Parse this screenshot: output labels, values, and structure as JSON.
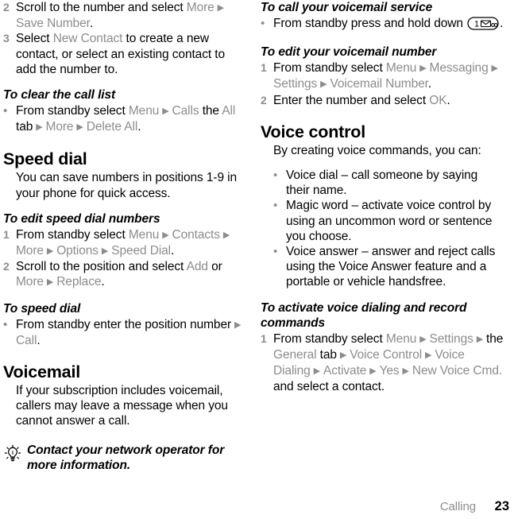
{
  "document": {
    "footer": {
      "chapter": "Calling",
      "page_number": "23"
    }
  },
  "left_column": {
    "blocks": [
      {
        "type": "numbered-item",
        "number": "2",
        "segments": [
          {
            "text": "Scroll to the number and select ",
            "style": "plain"
          },
          {
            "text": "More",
            "style": "ui"
          },
          {
            "text": " ▶ ",
            "style": "arrow"
          },
          {
            "text": "Save Number",
            "style": "ui"
          },
          {
            "text": ".",
            "style": "plain"
          }
        ],
        "plain_text": "2 Scroll to the number and select More ▶ Save Number."
      },
      {
        "type": "numbered-item",
        "number": "3",
        "segments": [
          {
            "text": "Select ",
            "style": "plain"
          },
          {
            "text": "New Contact",
            "style": "ui"
          },
          {
            "text": " to create a new contact, or select an existing contact to add the number to.",
            "style": "plain"
          }
        ],
        "plain_text": "3 Select New Contact to create a new contact, or select an existing contact to add the number to."
      },
      {
        "type": "heading2",
        "text": "To clear the call list"
      },
      {
        "type": "bullet-item",
        "segments": [
          {
            "text": "From standby select ",
            "style": "plain"
          },
          {
            "text": "Menu",
            "style": "ui"
          },
          {
            "text": " ▶ ",
            "style": "arrow"
          },
          {
            "text": "Calls",
            "style": "ui"
          },
          {
            "text": " the ",
            "style": "plain"
          },
          {
            "text": "All",
            "style": "ui"
          },
          {
            "text": " tab",
            "style": "plain"
          },
          {
            "text": " ▶ ",
            "style": "arrow"
          },
          {
            "text": "More",
            "style": "ui"
          },
          {
            "text": " ▶ ",
            "style": "arrow"
          },
          {
            "text": "Delete All",
            "style": "ui"
          },
          {
            "text": ".",
            "style": "plain"
          }
        ],
        "plain_text": "From standby select Menu ▶ Calls the All tab ▶ More ▶ Delete All."
      },
      {
        "type": "heading1",
        "text": "Speed dial"
      },
      {
        "type": "paragraph",
        "text": "You can save numbers in positions 1-9 in your phone for quick access."
      },
      {
        "type": "heading2",
        "text": "To edit speed dial numbers"
      },
      {
        "type": "numbered-item",
        "number": "1",
        "segments": [
          {
            "text": "From standby select ",
            "style": "plain"
          },
          {
            "text": "Menu",
            "style": "ui"
          },
          {
            "text": " ▶ ",
            "style": "arrow"
          },
          {
            "text": "Contacts",
            "style": "ui"
          },
          {
            "text": " ▶ ",
            "style": "arrow"
          },
          {
            "text": "More",
            "style": "ui"
          },
          {
            "text": " ▶ ",
            "style": "arrow"
          },
          {
            "text": "Options",
            "style": "ui"
          },
          {
            "text": " ▶ ",
            "style": "arrow"
          },
          {
            "text": "Speed Dial",
            "style": "ui"
          },
          {
            "text": ".",
            "style": "plain"
          }
        ],
        "plain_text": "1 From standby select Menu ▶ Contacts ▶ More ▶ Options ▶ Speed Dial."
      },
      {
        "type": "numbered-item",
        "number": "2",
        "segments": [
          {
            "text": "Scroll to the position and select ",
            "style": "plain"
          },
          {
            "text": "Add",
            "style": "ui"
          },
          {
            "text": " or ",
            "style": "plain"
          },
          {
            "text": "More",
            "style": "ui"
          },
          {
            "text": " ▶ ",
            "style": "arrow"
          },
          {
            "text": "Replace",
            "style": "ui"
          },
          {
            "text": ".",
            "style": "plain"
          }
        ],
        "plain_text": "2 Scroll to the position and select Add or More ▶ Replace."
      },
      {
        "type": "heading2",
        "text": "To speed dial"
      },
      {
        "type": "bullet-item",
        "segments": [
          {
            "text": "From standby enter the position number",
            "style": "plain"
          },
          {
            "text": " ▶ ",
            "style": "arrow"
          },
          {
            "text": "Call",
            "style": "ui"
          },
          {
            "text": ".",
            "style": "plain"
          }
        ],
        "plain_text": "From standby enter the position number ▶ Call."
      },
      {
        "type": "heading1",
        "text": "Voicemail"
      },
      {
        "type": "paragraph",
        "text": "If your subscription includes voicemail, callers may leave a message when you cannot answer a call."
      },
      {
        "type": "tip",
        "icon": "lightbulb-icon",
        "text": "Contact your network operator for more information."
      }
    ]
  },
  "right_column": {
    "blocks": [
      {
        "type": "heading2",
        "text": "To call your voicemail service"
      },
      {
        "type": "bullet-item-key",
        "segments": [
          {
            "text": "From standby press and hold down ",
            "style": "plain"
          },
          {
            "text": "",
            "style": "key",
            "key_label": "1",
            "key_icon": "voicemail-envelope-icon"
          },
          {
            "text": ".",
            "style": "plain"
          }
        ],
        "plain_text": "From standby press and hold down (1 ✉)."
      },
      {
        "type": "heading2",
        "text": "To edit your voicemail number"
      },
      {
        "type": "numbered-item",
        "number": "1",
        "segments": [
          {
            "text": "From standby select ",
            "style": "plain"
          },
          {
            "text": "Menu",
            "style": "ui"
          },
          {
            "text": " ▶ ",
            "style": "arrow"
          },
          {
            "text": "Messaging",
            "style": "ui"
          },
          {
            "text": " ▶ ",
            "style": "arrow"
          },
          {
            "text": "Settings",
            "style": "ui"
          },
          {
            "text": " ▶ ",
            "style": "arrow"
          },
          {
            "text": "Voicemail Number",
            "style": "ui"
          },
          {
            "text": ".",
            "style": "plain"
          }
        ],
        "plain_text": "1 From standby select Menu ▶ Messaging ▶ Settings ▶ Voicemail Number."
      },
      {
        "type": "numbered-item",
        "number": "2",
        "segments": [
          {
            "text": "Enter the number and select ",
            "style": "plain"
          },
          {
            "text": "OK",
            "style": "ui"
          },
          {
            "text": ".",
            "style": "plain"
          }
        ],
        "plain_text": "2 Enter the number and select OK."
      },
      {
        "type": "heading1",
        "text": "Voice control"
      },
      {
        "type": "paragraph",
        "text": "By creating voice commands, you can:"
      },
      {
        "type": "sub-bullet",
        "text": "Voice dial – call someone by saying their name."
      },
      {
        "type": "sub-bullet",
        "text": "Magic word – activate voice control by using an uncommon word or sentence you choose."
      },
      {
        "type": "sub-bullet",
        "text": "Voice answer – answer and reject calls using the Voice Answer feature and a portable or vehicle handsfree."
      },
      {
        "type": "heading2",
        "text": "To activate voice dialing and record commands"
      },
      {
        "type": "numbered-item",
        "number": "1",
        "segments": [
          {
            "text": "From standby select ",
            "style": "plain"
          },
          {
            "text": "Menu",
            "style": "ui"
          },
          {
            "text": " ▶ ",
            "style": "arrow"
          },
          {
            "text": "Settings",
            "style": "ui"
          },
          {
            "text": " ▶ ",
            "style": "arrow"
          },
          {
            "text": "the ",
            "style": "plain"
          },
          {
            "text": "General",
            "style": "ui"
          },
          {
            "text": " tab",
            "style": "plain"
          },
          {
            "text": " ▶ ",
            "style": "arrow"
          },
          {
            "text": "Voice Control",
            "style": "ui"
          },
          {
            "text": " ▶ ",
            "style": "arrow"
          },
          {
            "text": "Voice Dialing",
            "style": "ui"
          },
          {
            "text": " ▶ ",
            "style": "arrow"
          },
          {
            "text": "Activate",
            "style": "ui"
          },
          {
            "text": " ▶ ",
            "style": "arrow"
          },
          {
            "text": "Yes",
            "style": "ui"
          },
          {
            "text": " ▶ ",
            "style": "arrow"
          },
          {
            "text": "New Voice Cmd.",
            "style": "ui"
          },
          {
            "text": " and select a contact.",
            "style": "plain"
          }
        ],
        "plain_text": "1 From standby select Menu ▶ Settings ▶ the General tab ▶ Voice Control ▶ Voice Dialing ▶ Activate ▶ Yes ▶ New Voice Cmd. and select a contact."
      }
    ]
  },
  "colors": {
    "ui_term_gray": "#8c8c8c",
    "body_black": "#000000",
    "page_background": "#ffffff"
  }
}
